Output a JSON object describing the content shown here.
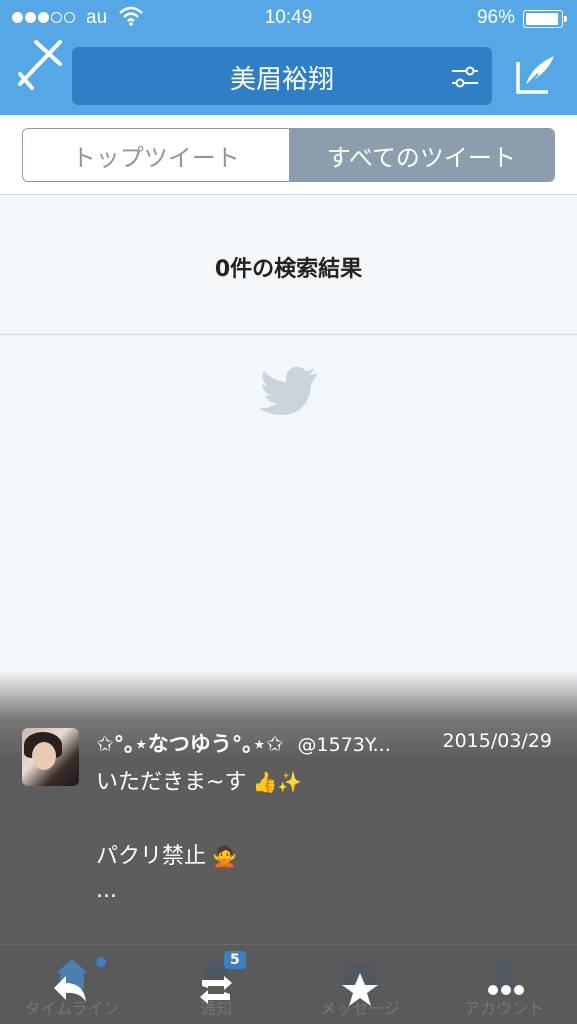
{
  "status_bar": {
    "carrier": "au",
    "time": "10:49",
    "battery": "96%",
    "battery_level": 0.96,
    "signal_bars_filled": 3,
    "signal_bars_total": 5
  },
  "nav": {
    "search_query": "美眉裕翔",
    "close_icon": "close-back-icon",
    "filter_icon": "sliders-icon",
    "compose_icon": "compose-icon"
  },
  "segments": {
    "top_tweets": "トップツイート",
    "all_tweets": "すべてのツイート",
    "selected": "all_tweets"
  },
  "results": {
    "count_text": "0件の検索結果"
  },
  "notification": {
    "display_name": "✩°｡⋆なつゆう°｡⋆✩",
    "handle": "@1573Y...",
    "date": "2015/03/29",
    "line1": "いただきま~す",
    "line1_emoji": "👍✨",
    "line2": "パクリ禁止",
    "line2_emoji": "🙅",
    "line3": "..."
  },
  "tabbar": {
    "items": [
      {
        "label": "タイムライン",
        "icon": "home-icon"
      },
      {
        "label": "通知",
        "icon": "notification-icon",
        "badge": "5"
      },
      {
        "label": "メッセージ",
        "icon": "envelope-icon"
      },
      {
        "label": "アカウント",
        "icon": "person-icon"
      }
    ]
  },
  "colors": {
    "header": "#55a7e6",
    "search_bar": "#2e7fc6",
    "overlay": "#5d5d5d",
    "selected_segment": "#8c9eae"
  }
}
